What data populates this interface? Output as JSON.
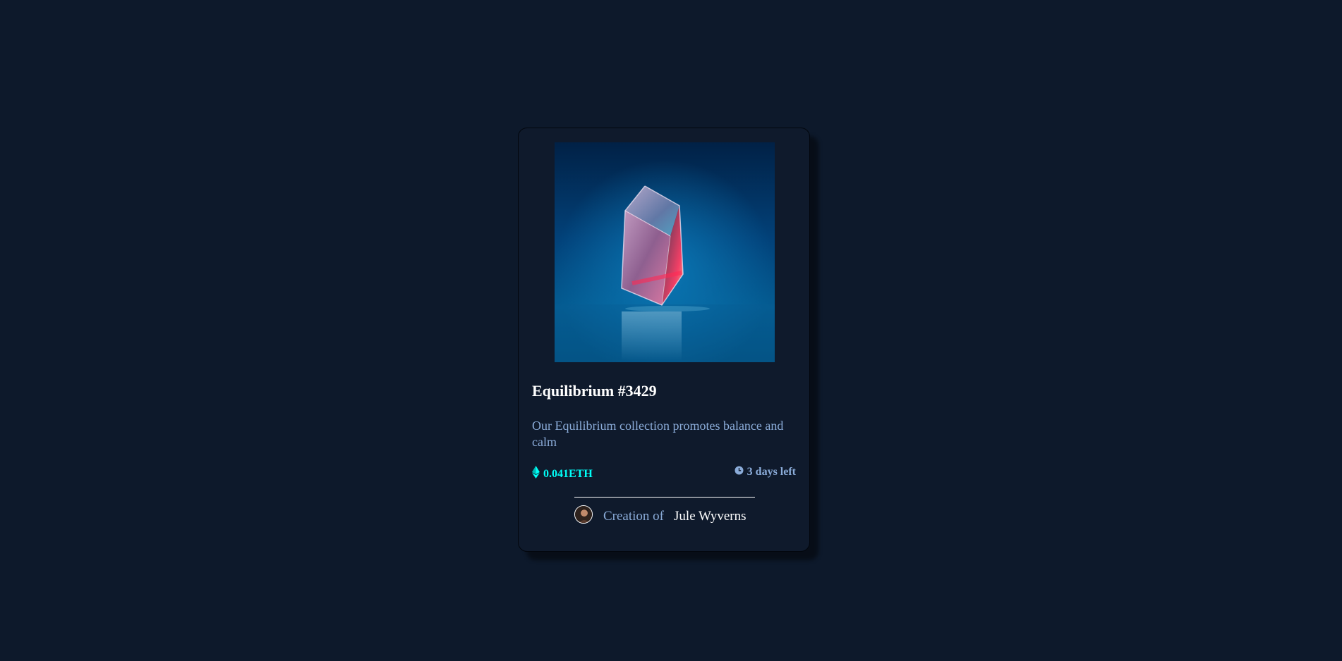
{
  "card": {
    "title": "Equilibrium #3429",
    "description": "Our Equilibrium collection promotes balance and calm",
    "price": "0.041ETH",
    "time_left": "3 days left",
    "creator_prefix": "Creation of",
    "creator_name": "Jule Wyverns"
  },
  "icons": {
    "hero": "crystal-cube-image",
    "price": "ethereum-icon",
    "time": "clock-icon",
    "avatar": "avatar-image"
  },
  "colors": {
    "page_bg": "#0d192b",
    "card_bg": "#0f1a2c",
    "accent_cyan": "#00fff8",
    "soft_blue": "#8bacd9",
    "white": "#ffffff"
  }
}
